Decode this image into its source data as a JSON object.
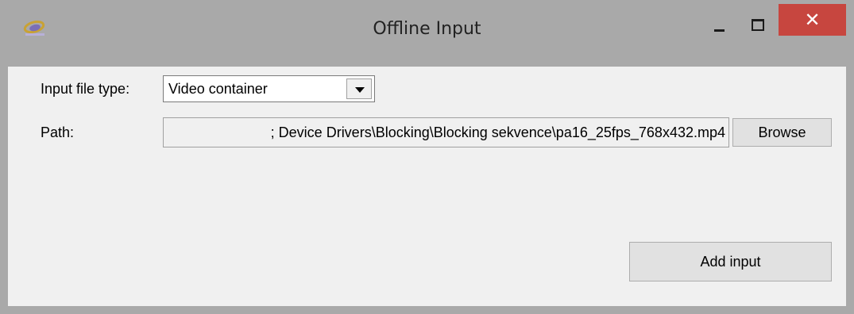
{
  "window": {
    "title": "Offline Input",
    "close_glyph": "✕"
  },
  "form": {
    "input_file_type_label": "Input file type:",
    "input_file_type_value": "Video container",
    "path_label": "Path:",
    "path_value": "; Device Drivers\\Blocking\\Blocking sekvence\\pa16_25fps_768x432.mp4",
    "browse_label": "Browse",
    "add_input_label": "Add input"
  },
  "colors": {
    "frame": "#a9a9a9",
    "client": "#f0f0f0",
    "close_button": "#c7463f"
  },
  "icons": {
    "app": "app-logo-icon",
    "minimize": "minimize-icon",
    "maximize": "maximize-icon",
    "close": "close-icon",
    "dropdown": "chevron-down-icon"
  }
}
